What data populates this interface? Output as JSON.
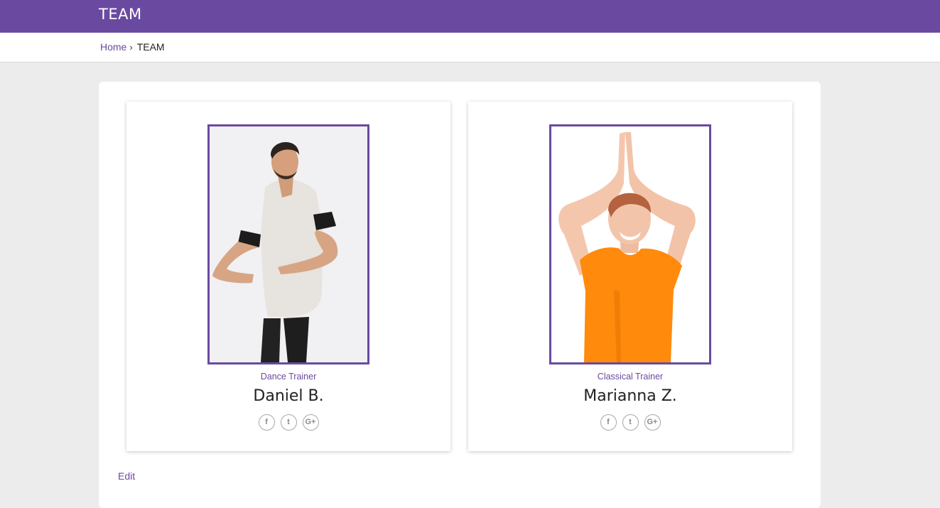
{
  "header": {
    "title": "TEAM",
    "bg_color": "#6a4aa0"
  },
  "breadcrumb": {
    "home": "Home",
    "separator": "›",
    "current": "TEAM"
  },
  "team": [
    {
      "role": "Dance Trainer",
      "name": "Daniel B.",
      "socials": [
        "facebook-icon",
        "twitter-icon",
        "google-plus-icon"
      ]
    },
    {
      "role": "Classical Trainer",
      "name": "Marianna Z.",
      "socials": [
        "facebook-icon",
        "twitter-icon",
        "google-plus-icon"
      ]
    }
  ],
  "social_glyphs": {
    "facebook": "f",
    "twitter": "t",
    "google": "G+"
  },
  "footer": {
    "edit_label": "Edit"
  }
}
